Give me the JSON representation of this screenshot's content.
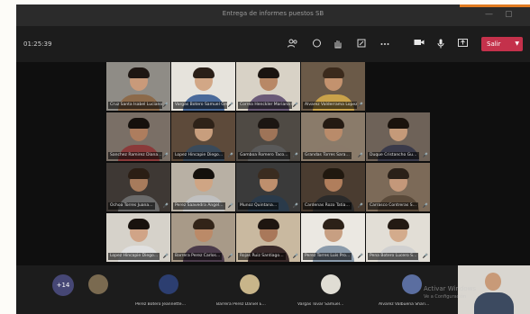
{
  "window": {
    "title": "Entrega de informes puestos SB",
    "minimize": "—",
    "maximize": "▢"
  },
  "toolbar": {
    "timer": "01:25:39",
    "icons": [
      "people-icon",
      "chat-icon",
      "raise-hand-icon",
      "share-tray-icon",
      "more-icon",
      "camera-icon",
      "mic-icon",
      "share-icon"
    ],
    "leave_label": "Salir",
    "accent_color": "#c4314b"
  },
  "participants": [
    {
      "name": "Cruz Santa Isabel Luciano",
      "mic": "🎤"
    },
    {
      "name": "Vargas Botero Samuel Grego…",
      "mic": "🎤"
    },
    {
      "name": "Correa Henckler Mariana El…",
      "mic": "🎤"
    },
    {
      "name": "Alvarez Valderrama Lopez A…",
      "mic": "🎤"
    },
    {
      "name": "Sanchez Ramirez Diana…",
      "mic": "🎤"
    },
    {
      "name": "Lopez Hincapie Diego…",
      "mic": "🎤"
    },
    {
      "name": "Gamboa Romero Taco…",
      "mic": "🎤"
    },
    {
      "name": "Grandas Torres Sara…",
      "mic": "🎤"
    },
    {
      "name": "Duque Cristancho Gu…",
      "mic": "🎤"
    },
    {
      "name": "Ochoa Torres Juana…",
      "mic": "🎤"
    },
    {
      "name": "Perez Saavedra Angel…",
      "mic": "🎤"
    },
    {
      "name": "Munoz Quintana…",
      "mic": "🎤"
    },
    {
      "name": "Cardenas Rozo Tatia…",
      "mic": "🎤"
    },
    {
      "name": "Carrasco Contreras S…",
      "mic": "🎤"
    },
    {
      "name": "Lopez Hincapie Diego…",
      "mic": "🎤"
    },
    {
      "name": "Barrera Perez Carlos…",
      "mic": "🎤"
    },
    {
      "name": "Rojas Ruiz Santiago…",
      "mic": "🎤"
    },
    {
      "name": "Perez Torres Luis Pro…",
      "mic": "🎤"
    },
    {
      "name": "Pena Botero Lucero S…",
      "mic": "🎤"
    }
  ],
  "bottom": {
    "more_count": "+14",
    "participants": [
      {
        "name": "Perez Botero Jeannette…"
      },
      {
        "name": "Barrera Perez Daniel E…"
      },
      {
        "name": "Vargas Tovar Samuel…"
      },
      {
        "name": "Alvarez Valbuena Shari…"
      }
    ]
  },
  "watermark": {
    "line1": "Activar Windows",
    "line2": "Ve a Configuración"
  }
}
